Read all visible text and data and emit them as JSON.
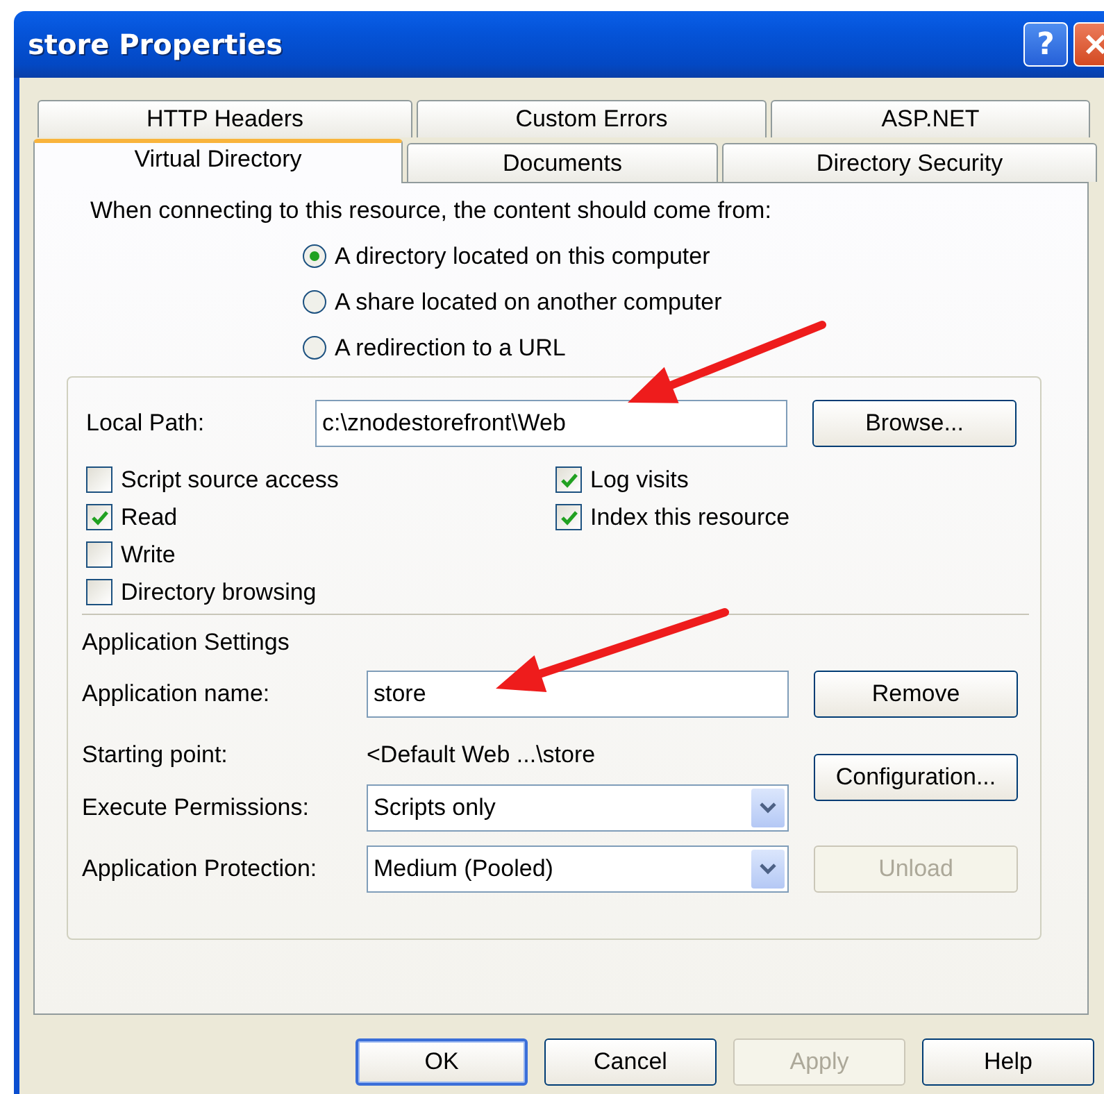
{
  "window": {
    "title": "store Properties",
    "help_button": "?"
  },
  "tab_rows": [
    {
      "tabs": [
        {
          "label": "HTTP Headers",
          "selected": false
        },
        {
          "label": "Custom Errors",
          "selected": false
        },
        {
          "label": "ASP.NET",
          "selected": false
        }
      ]
    },
    {
      "tabs": [
        {
          "label": "Virtual Directory",
          "selected": true
        },
        {
          "label": "Documents",
          "selected": false
        },
        {
          "label": "Directory Security",
          "selected": false
        }
      ]
    }
  ],
  "content_source": {
    "prompt": "When connecting to this resource, the content should come from:",
    "options": [
      {
        "label": "A directory located on this computer",
        "selected": true
      },
      {
        "label": "A share located on another computer",
        "selected": false
      },
      {
        "label": "A redirection to a URL",
        "selected": false
      }
    ]
  },
  "local_path": {
    "label": "Local Path:",
    "value": "c:\\znodestorefront\\Web",
    "button": "Browse..."
  },
  "permissions_left": [
    {
      "label": "Script source access",
      "checked": false
    },
    {
      "label": "Read",
      "checked": true
    },
    {
      "label": "Write",
      "checked": false
    },
    {
      "label": "Directory browsing",
      "checked": false
    }
  ],
  "permissions_right": [
    {
      "label": "Log visits",
      "checked": true
    },
    {
      "label": "Index this resource",
      "checked": true
    }
  ],
  "app_settings": {
    "heading": "Application Settings",
    "name": {
      "label": "Application name:",
      "value": "store",
      "button": "Remove"
    },
    "starting_point": {
      "label": "Starting point:",
      "value": "<Default Web ...\\store",
      "button": "Configuration..."
    },
    "execute_permissions": {
      "label": "Execute Permissions:",
      "value": "Scripts only"
    },
    "protection": {
      "label": "Application Protection:",
      "value": "Medium (Pooled)"
    },
    "unload_button": {
      "label": "Unload",
      "disabled": true
    }
  },
  "buttons": [
    {
      "label": "OK",
      "disabled": false,
      "default": true
    },
    {
      "label": "Cancel",
      "disabled": false,
      "default": false
    },
    {
      "label": "Apply",
      "disabled": true,
      "default": false
    },
    {
      "label": "Help",
      "disabled": false,
      "default": false
    }
  ],
  "annotations": [
    {
      "kind": "arrow"
    },
    {
      "kind": "arrow"
    }
  ]
}
